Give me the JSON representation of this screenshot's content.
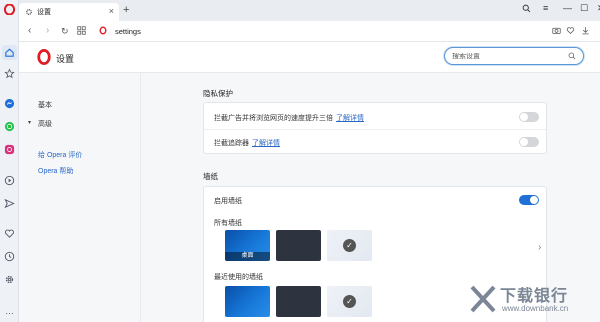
{
  "tab": {
    "title": "设置",
    "close": "×",
    "new_tab": "+"
  },
  "window": {
    "min": "—",
    "max": "☐",
    "close": "✕",
    "menu": "≡"
  },
  "address": {
    "url": "settings"
  },
  "header": {
    "title": "设置",
    "search_placeholder": "搜索设置"
  },
  "sidebar": {
    "items": [
      {
        "label": "基本"
      },
      {
        "label": "高级",
        "chevron": "▾"
      }
    ],
    "links": [
      {
        "label": "给 Opera 评价"
      },
      {
        "label": "Opera 帮助"
      }
    ]
  },
  "privacy": {
    "title": "隐私保护",
    "rows": [
      {
        "label": "拦截广告并将浏览网页的速度提升三倍",
        "link": "了解详情",
        "enabled": false
      },
      {
        "label": "拦截追踪器",
        "link": "了解详情",
        "enabled": false
      }
    ]
  },
  "wallpaper": {
    "title": "墙纸",
    "enable_label": "启用墙纸",
    "enabled": true,
    "all_label": "所有墙纸",
    "recent_label": "最近使用的墙纸",
    "desktop_caption": "桌面",
    "next": "›"
  },
  "watermark": {
    "title": "下载银行",
    "url": "www.downbank.cn"
  },
  "colors": {
    "accent": "#1f71d6",
    "link": "#2767c5",
    "opera_red": "#e01b24"
  },
  "icons": [
    "opera-logo-icon",
    "home-icon",
    "star-icon",
    "messenger-icon",
    "whatsapp-icon",
    "instagram-icon",
    "player-icon",
    "send-icon",
    "heart-icon",
    "history-icon",
    "gear-icon",
    "search-icon",
    "camera-icon",
    "heart-icon",
    "menu-icon",
    "check-icon"
  ]
}
